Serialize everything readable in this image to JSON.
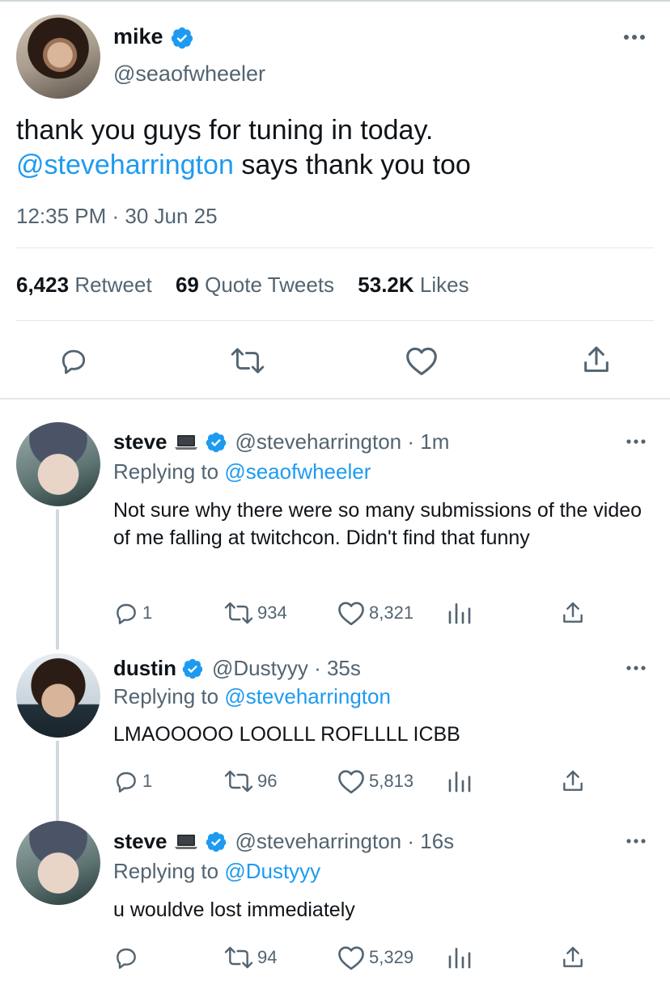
{
  "main_tweet": {
    "name": "mike",
    "handle": "@seaofwheeler",
    "text_line1": "thank you guys for tuning in today.",
    "mention": "@steveharrington",
    "text_line2_rest": " says thank you too",
    "timestamp": "12:35 PM · 30 Jun 25",
    "stats": {
      "retweets": "6,423",
      "retweets_label": "Retweet",
      "quotes": "69",
      "quotes_label": "Quote Tweets",
      "likes": "53.2K",
      "likes_label": "Likes"
    }
  },
  "replies": [
    {
      "name": "steve",
      "emoji_icon": "laptop-icon",
      "handle": "@steveharrington",
      "sep": " · ",
      "time": "1m",
      "replying_prefix": "Replying to ",
      "replying_to": "@seaofwheeler",
      "text": "Not sure why there were so many submissions of the video of me falling at twitchcon. Didn't find that funny",
      "replies": "1",
      "retweets": "934",
      "likes": "8,321"
    },
    {
      "name": "dustin",
      "handle": "@Dustyyy",
      "sep": " · ",
      "time": "35s",
      "replying_prefix": "Replying to ",
      "replying_to": "@steveharrington",
      "text": "LMAOOOOO LOOLLL ROFLLLL ICBB",
      "replies": "1",
      "retweets": "96",
      "likes": "5,813"
    },
    {
      "name": "steve",
      "emoji_icon": "laptop-icon",
      "handle": "@steveharrington",
      "sep": " · ",
      "time": "16s",
      "replying_prefix": "Replying to ",
      "replying_to": "@Dustyyy",
      "text": "u wouldve lost immediately",
      "replies": "",
      "retweets": "94",
      "likes": "5,329"
    }
  ],
  "colors": {
    "accent": "#1d9bf0",
    "secondary_text": "#536471",
    "primary_text": "#0f1419"
  }
}
